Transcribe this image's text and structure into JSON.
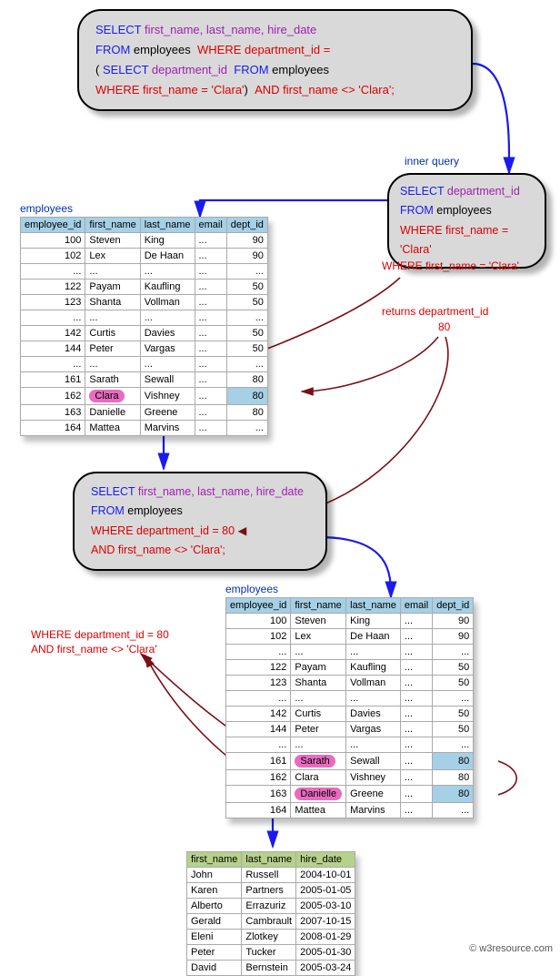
{
  "sql": {
    "title": {
      "select": "SELECT ",
      "cols": "first_name, last_name, hire_date",
      "from": "FROM ",
      "table": "employees",
      "where": "WHERE ",
      "dept_eq": "department_id =",
      "inner_select": "SELECT ",
      "inner_col": "department_id",
      "inner_from": "FROM ",
      "inner_table": "employees",
      "inner_where": "WHERE first_name = 'Clara'",
      "and": "AND ",
      "neq": "first_name <> 'Clara';"
    },
    "inner": {
      "select": "SELECT ",
      "col": "department_id",
      "from": "FROM ",
      "table": "employees",
      "where": "WHERE first_name = 'Clara'"
    },
    "outer": {
      "select": "SELECT ",
      "cols": "first_name, last_name, hire_date",
      "from": "FROM ",
      "table": "employees",
      "where": "WHERE ",
      "dept80": "department_id = 80",
      "and": "AND ",
      "neq": "first_name <> 'Clara';"
    }
  },
  "labels": {
    "inner_query": "inner query",
    "clara_filter": "WHERE first_name = 'Clara'",
    "returns_dept": "returns department_id",
    "dept_value": "80",
    "employees": "employees",
    "outer_filter_l1": "WHERE department_id = 80",
    "outer_filter_l2": "AND first_name <> 'Clara'"
  },
  "t1": {
    "headers": [
      "employee_id",
      "first_name",
      "last_name",
      "email",
      "dept_id"
    ],
    "rows": [
      {
        "id": "100",
        "fn": "Steven",
        "ln": "King",
        "em": "...",
        "d": "90"
      },
      {
        "id": "102",
        "fn": "Lex",
        "ln": "De Haan",
        "em": "...",
        "d": "90"
      },
      {
        "id": "...",
        "fn": "...",
        "ln": "...",
        "em": "...",
        "d": "..."
      },
      {
        "id": "122",
        "fn": "Payam",
        "ln": "Kaufling",
        "em": "...",
        "d": "50"
      },
      {
        "id": "123",
        "fn": "Shanta",
        "ln": "Vollman",
        "em": "...",
        "d": "50"
      },
      {
        "id": "...",
        "fn": "...",
        "ln": "...",
        "em": "...",
        "d": "..."
      },
      {
        "id": "142",
        "fn": "Curtis",
        "ln": "Davies",
        "em": "...",
        "d": "50"
      },
      {
        "id": "144",
        "fn": "Peter",
        "ln": "Vargas",
        "em": "...",
        "d": "50"
      },
      {
        "id": "...",
        "fn": "...",
        "ln": "...",
        "em": "...",
        "d": "..."
      },
      {
        "id": "161",
        "fn": "Sarath",
        "ln": "Sewall",
        "em": "...",
        "d": "80"
      },
      {
        "id": "162",
        "fn": "Clara",
        "ln": "Vishney",
        "em": "...",
        "d": "80",
        "hl_fn": true,
        "hl_d": true
      },
      {
        "id": "163",
        "fn": "Danielle",
        "ln": "Greene",
        "em": "...",
        "d": "80"
      },
      {
        "id": "164",
        "fn": "Mattea",
        "ln": "Marvins",
        "em": "...",
        "d": "..."
      }
    ]
  },
  "t2": {
    "headers": [
      "employee_id",
      "first_name",
      "last_name",
      "email",
      "dept_id"
    ],
    "rows": [
      {
        "id": "100",
        "fn": "Steven",
        "ln": "King",
        "em": "...",
        "d": "90"
      },
      {
        "id": "102",
        "fn": "Lex",
        "ln": "De Haan",
        "em": "...",
        "d": "90"
      },
      {
        "id": "...",
        "fn": "...",
        "ln": "...",
        "em": "...",
        "d": "..."
      },
      {
        "id": "122",
        "fn": "Payam",
        "ln": "Kaufling",
        "em": "...",
        "d": "50"
      },
      {
        "id": "123",
        "fn": "Shanta",
        "ln": "Vollman",
        "em": "...",
        "d": "50"
      },
      {
        "id": "...",
        "fn": "...",
        "ln": "...",
        "em": "...",
        "d": "..."
      },
      {
        "id": "142",
        "fn": "Curtis",
        "ln": "Davies",
        "em": "...",
        "d": "50"
      },
      {
        "id": "144",
        "fn": "Peter",
        "ln": "Vargas",
        "em": "...",
        "d": "50"
      },
      {
        "id": "...",
        "fn": "...",
        "ln": "...",
        "em": "...",
        "d": "..."
      },
      {
        "id": "161",
        "fn": "Sarath",
        "ln": "Sewall",
        "em": "...",
        "d": "80",
        "hl_fn": true,
        "hl_d": true
      },
      {
        "id": "162",
        "fn": "Clara",
        "ln": "Vishney",
        "em": "...",
        "d": "80"
      },
      {
        "id": "163",
        "fn": "Danielle",
        "ln": "Greene",
        "em": "...",
        "d": "80",
        "hl_fn": true,
        "hl_d": true
      },
      {
        "id": "164",
        "fn": "Mattea",
        "ln": "Marvins",
        "em": "...",
        "d": "..."
      }
    ]
  },
  "t3": {
    "headers": [
      "first_name",
      "last_name",
      "hire_date"
    ],
    "rows": [
      {
        "fn": "John",
        "ln": "Russell",
        "hd": "2004-10-01"
      },
      {
        "fn": "Karen",
        "ln": "Partners",
        "hd": "2005-01-05"
      },
      {
        "fn": "Alberto",
        "ln": "Errazuriz",
        "hd": "2005-03-10"
      },
      {
        "fn": "Gerald",
        "ln": "Cambrault",
        "hd": "2007-10-15"
      },
      {
        "fn": "Eleni",
        "ln": "Zlotkey",
        "hd": "2008-01-29"
      },
      {
        "fn": "Peter",
        "ln": "Tucker",
        "hd": "2005-01-30"
      },
      {
        "fn": "David",
        "ln": "Bernstein",
        "hd": "2005-03-24"
      }
    ]
  },
  "credit": "© w3resource.com"
}
